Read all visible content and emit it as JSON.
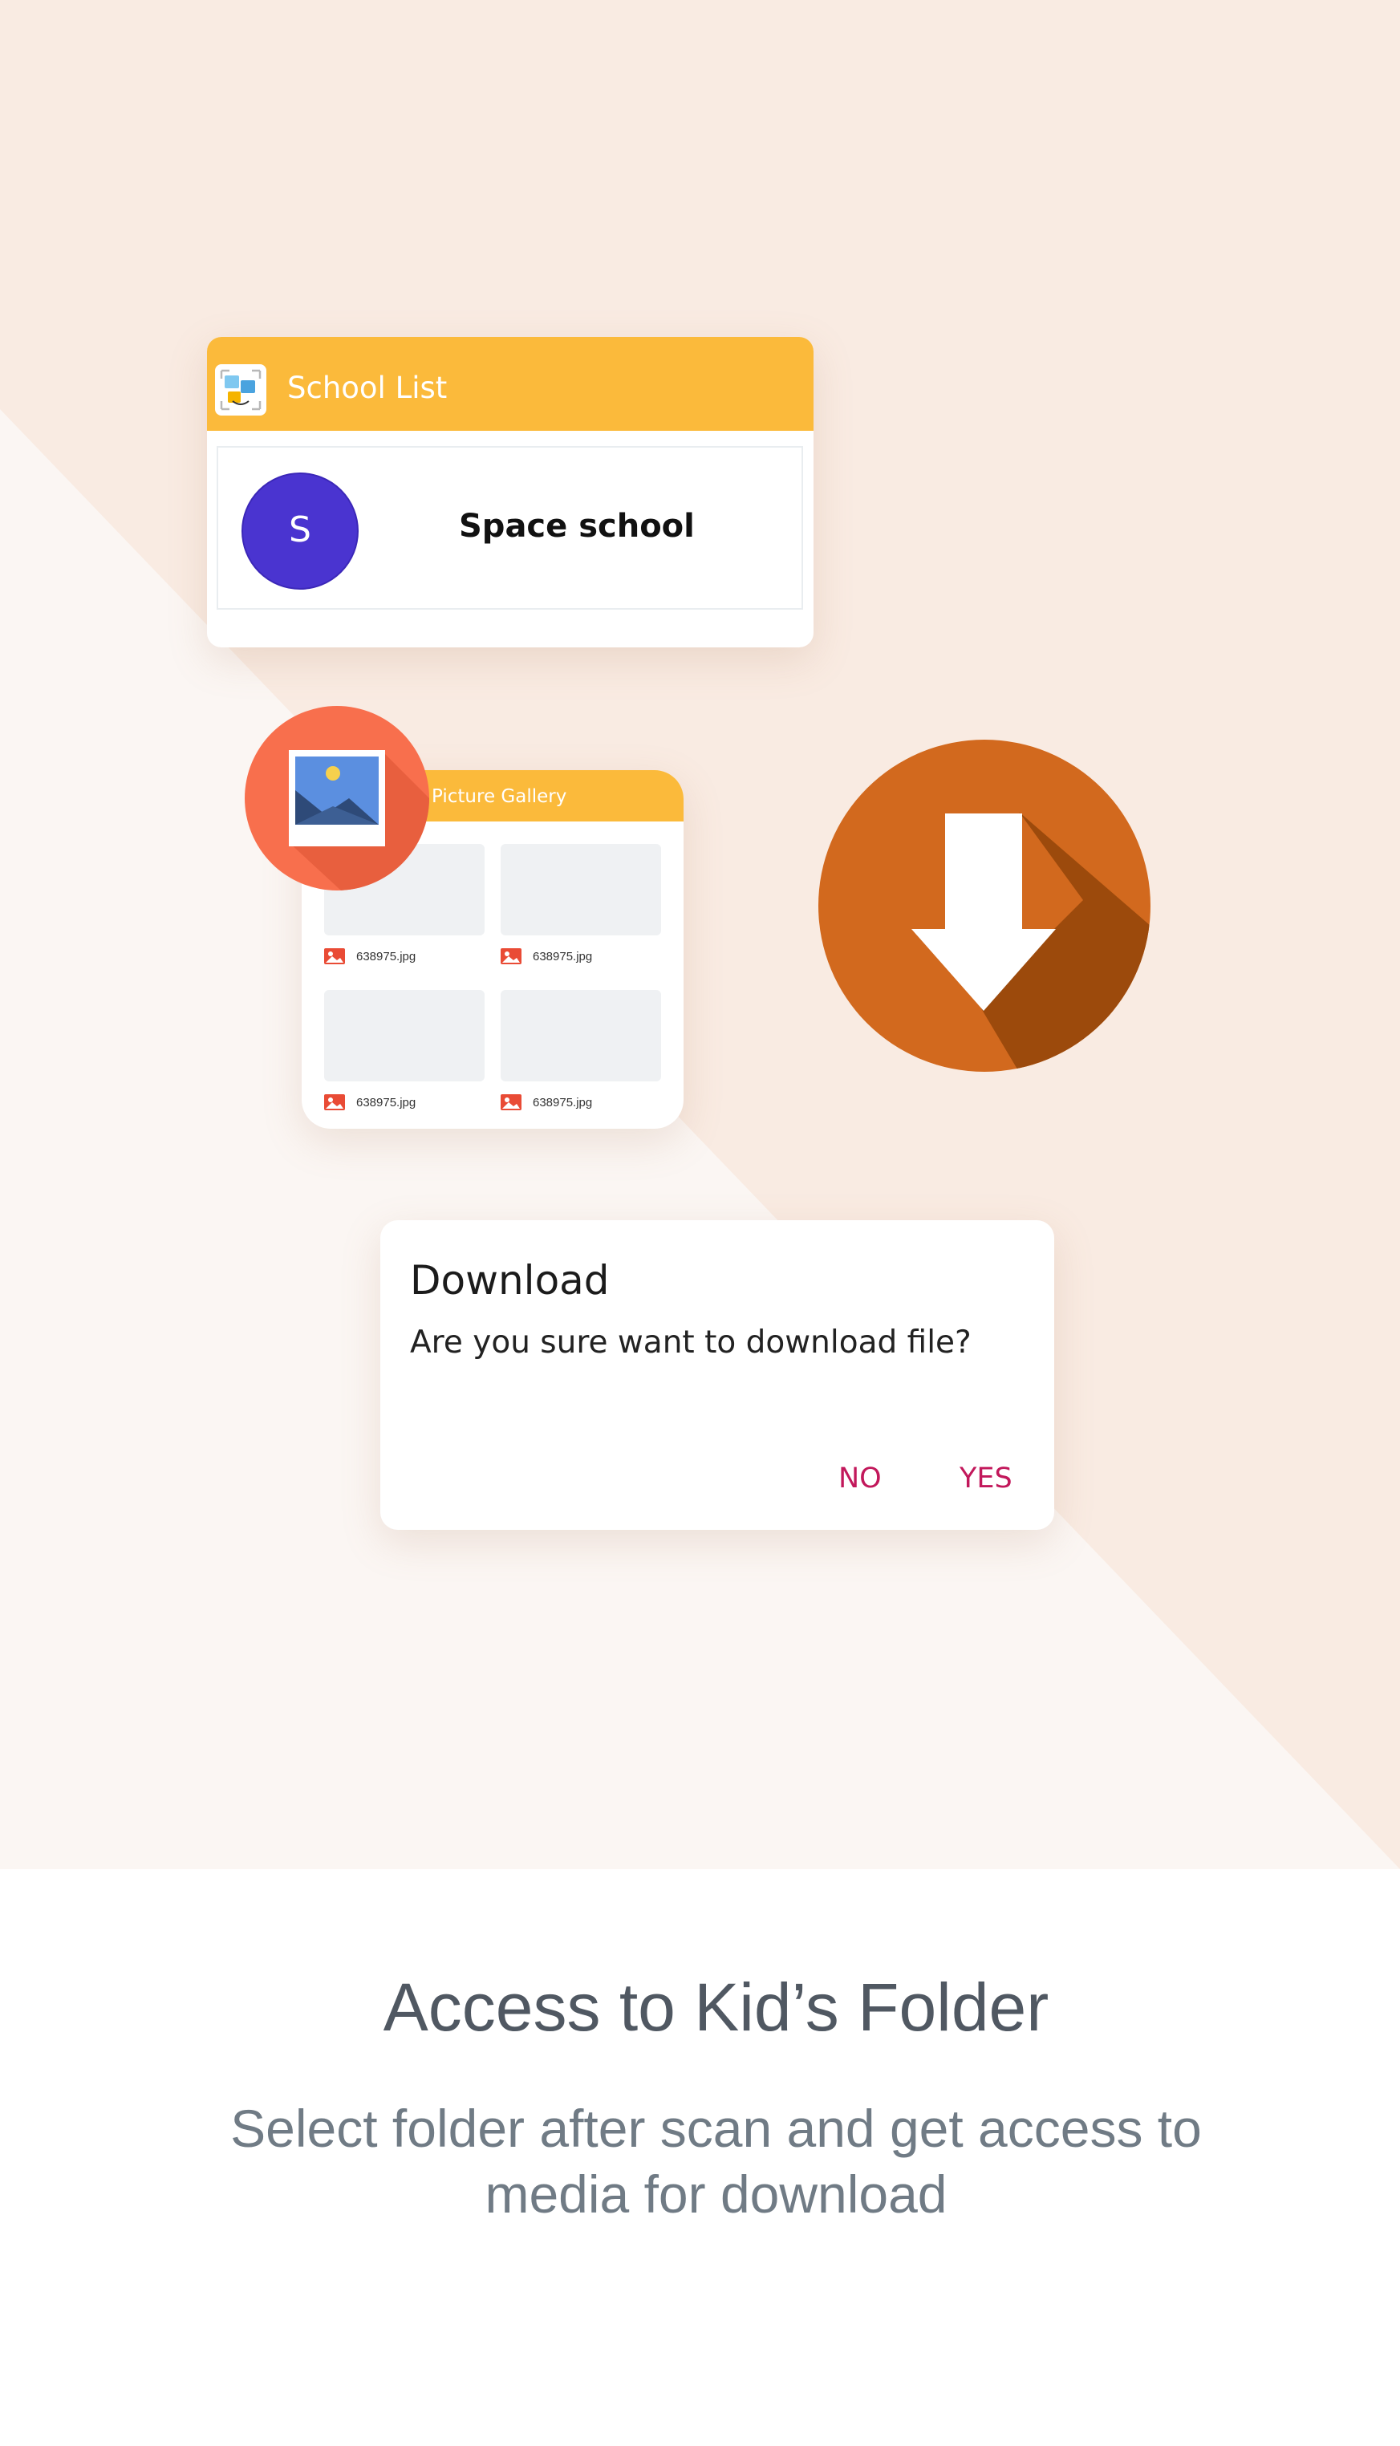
{
  "school_list": {
    "title": "School List",
    "items": [
      {
        "avatar_letter": "S",
        "name": "Space school",
        "avatar_color": "#4a34d0"
      }
    ]
  },
  "gallery": {
    "title": "Picture Gallery",
    "files": [
      "638975.jpg",
      "638975.jpg",
      "638975.jpg",
      "638975.jpg"
    ]
  },
  "dialog": {
    "title": "Download",
    "message": "Are you sure want to download file?",
    "no_label": "NO",
    "yes_label": "YES"
  },
  "caption": {
    "title": "Access to Kid’s Folder",
    "subtitle_line1": "Select folder after scan and get access to",
    "subtitle_line2": "media for download"
  },
  "colors": {
    "accent_yellow": "#fbba3b",
    "download_orange": "#d2691e",
    "gallery_icon_coral": "#f86f4d",
    "dialog_button": "#c2185b"
  },
  "icons": [
    "app-logo-icon",
    "picture-gallery-icon",
    "download-arrow-icon",
    "image-file-icon"
  ]
}
